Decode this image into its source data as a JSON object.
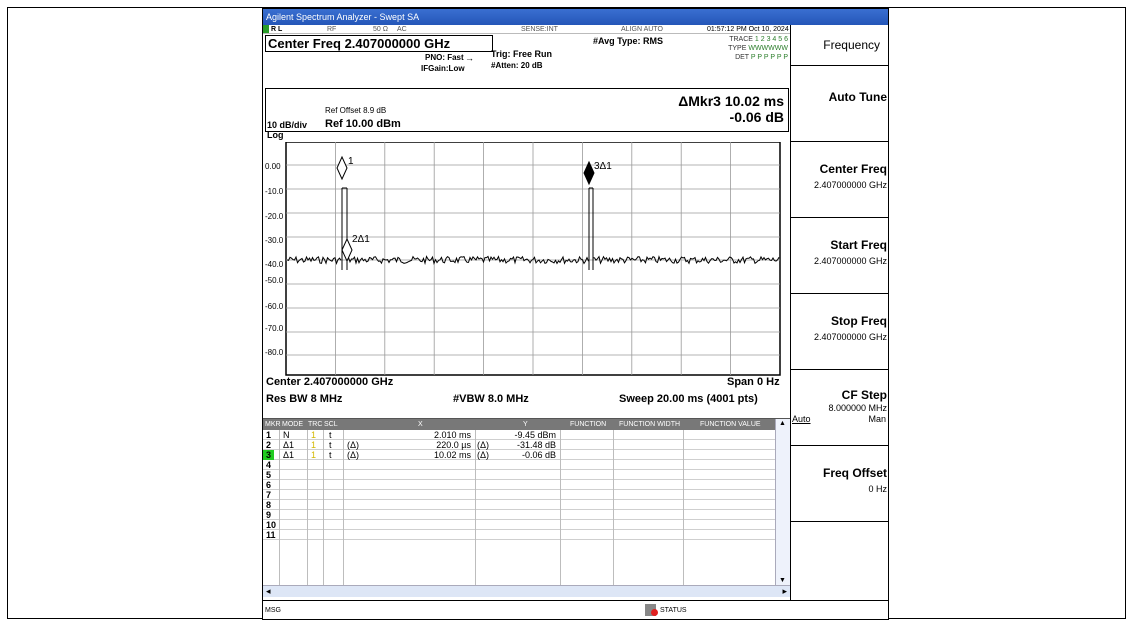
{
  "window": {
    "title": "Agilent Spectrum Analyzer - Swept SA"
  },
  "status_strip": {
    "rl": "R L",
    "rf": "RF",
    "impedance": "50 Ω",
    "coupling": "AC",
    "sense": "SENSE:INT",
    "align": "ALIGN AUTO",
    "datetime": "01:57:12 PM Oct 10, 2024"
  },
  "header": {
    "center_freq": "Center Freq 2.407000000 GHz",
    "pno": "PNO: Fast",
    "ifgain": "IFGain:Low",
    "trig": "Trig: Free Run",
    "atten": "#Atten: 20 dB",
    "avg_type": "#Avg Type: RMS",
    "trace_label": "TRACE",
    "trace_nums": "1 2 3 4 5 6",
    "type_label": "TYPE",
    "type_vals": "WWWWWW",
    "det_label": "DET",
    "det_vals": "P P P P P P"
  },
  "marker_readout": {
    "line1": "ΔMkr3 10.02 ms",
    "line2": "-0.06 dB",
    "ref_offset": "Ref Offset 8.9 dB",
    "ref_level": "Ref 10.00 dBm",
    "scale": "10 dB/div",
    "log": "Log"
  },
  "plot": {
    "y_labels": [
      "0.00",
      "-10.0",
      "-20.0",
      "-30.0",
      "-40.0",
      "-50.0",
      "-60.0",
      "-70.0",
      "-80.0"
    ],
    "markers": {
      "m1": "1",
      "m2": "2Δ1",
      "m3": "3Δ1"
    }
  },
  "bottom": {
    "center": "Center 2.407000000 GHz",
    "span": "Span 0 Hz",
    "res_bw": "Res BW 8 MHz",
    "vbw": "#VBW 8.0 MHz",
    "sweep": "Sweep  20.00 ms (4001 pts)"
  },
  "marker_table": {
    "headers": [
      "MKR",
      "MODE",
      "TRC",
      "SCL",
      "X",
      "Y",
      "FUNCTION",
      "FUNCTION WIDTH",
      "FUNCTION VALUE"
    ],
    "rows": [
      {
        "num": "1",
        "mode": "N",
        "trc": "1",
        "scl": "t",
        "xd": "",
        "x": "2.010 ms",
        "yd": "",
        "y": "-9.45 dBm"
      },
      {
        "num": "2",
        "mode": "Δ1",
        "trc": "1",
        "scl": "t",
        "xd": "(Δ)",
        "x": "220.0 µs",
        "yd": "(Δ)",
        "y": "-31.48 dB"
      },
      {
        "num": "3",
        "mode": "Δ1",
        "trc": "1",
        "scl": "t",
        "xd": "(Δ)",
        "x": "10.02 ms",
        "yd": "(Δ)",
        "y": "-0.06 dB"
      },
      {
        "num": "4",
        "mode": "",
        "trc": "",
        "scl": "",
        "xd": "",
        "x": "",
        "yd": "",
        "y": ""
      },
      {
        "num": "5",
        "mode": "",
        "trc": "",
        "scl": "",
        "xd": "",
        "x": "",
        "yd": "",
        "y": ""
      },
      {
        "num": "6",
        "mode": "",
        "trc": "",
        "scl": "",
        "xd": "",
        "x": "",
        "yd": "",
        "y": ""
      },
      {
        "num": "7",
        "mode": "",
        "trc": "",
        "scl": "",
        "xd": "",
        "x": "",
        "yd": "",
        "y": ""
      },
      {
        "num": "8",
        "mode": "",
        "trc": "",
        "scl": "",
        "xd": "",
        "x": "",
        "yd": "",
        "y": ""
      },
      {
        "num": "9",
        "mode": "",
        "trc": "",
        "scl": "",
        "xd": "",
        "x": "",
        "yd": "",
        "y": ""
      },
      {
        "num": "10",
        "mode": "",
        "trc": "",
        "scl": "",
        "xd": "",
        "x": "",
        "yd": "",
        "y": ""
      },
      {
        "num": "11",
        "mode": "",
        "trc": "",
        "scl": "",
        "xd": "",
        "x": "",
        "yd": "",
        "y": ""
      }
    ]
  },
  "softkeys": {
    "menu_title": "Frequency",
    "auto_tune": "Auto Tune",
    "center_freq": {
      "label": "Center Freq",
      "value": "2.407000000 GHz"
    },
    "start_freq": {
      "label": "Start Freq",
      "value": "2.407000000 GHz"
    },
    "stop_freq": {
      "label": "Stop Freq",
      "value": "2.407000000 GHz"
    },
    "cf_step": {
      "label": "CF Step",
      "value": "8.000000 MHz",
      "auto": "Auto",
      "man": "Man"
    },
    "freq_offset": {
      "label": "Freq Offset",
      "value": "0 Hz"
    }
  },
  "msgbar": {
    "msg": "MSG",
    "status": "STATUS"
  },
  "colors": {
    "titlebar": "#2c5fc4",
    "marker3_highlight": "#22cc22",
    "trace_yellow": "#d4b800"
  }
}
